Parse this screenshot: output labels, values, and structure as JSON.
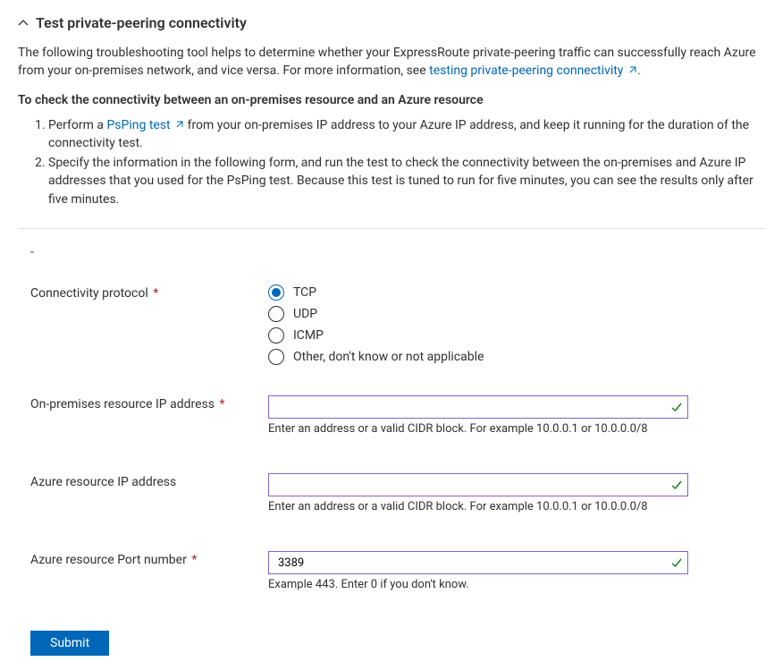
{
  "header": {
    "title": "Test private-peering connectivity"
  },
  "intro": {
    "prefix": "The following troubleshooting tool helps to determine whether your ExpressRoute private-peering traffic can successfully reach Azure from your on-premises network, and vice versa. For more information, see ",
    "link": "testing private-peering connectivity",
    "suffix": "."
  },
  "subheading": "To check the connectivity between an on-premises resource and an Azure resource",
  "steps": {
    "one_prefix": "Perform a ",
    "one_link": "PsPing test",
    "one_suffix": " from your on-premises IP address to your Azure IP address, and keep it running for the duration of the connectivity test.",
    "two": "Specify the information in the following form, and run the test to check the connectivity between the on-premises and Azure IP addresses that you used for the PsPing test. Because this test is tuned to run for five minutes, you can see the results only after five minutes."
  },
  "dash": "-",
  "form": {
    "protocol": {
      "label": "Connectivity protocol",
      "required_marker": "*",
      "options": {
        "tcp": "TCP",
        "udp": "UDP",
        "icmp": "ICMP",
        "other": "Other, don't know or not applicable"
      },
      "selected": "tcp"
    },
    "onprem_ip": {
      "label": "On-premises resource IP address",
      "required_marker": "*",
      "value": "",
      "hint": "Enter an address or a valid CIDR block. For example 10.0.0.1 or 10.0.0.0/8"
    },
    "azure_ip": {
      "label": "Azure resource IP address",
      "value": "",
      "hint": "Enter an address or a valid CIDR block. For example 10.0.0.1 or 10.0.0.0/8"
    },
    "azure_port": {
      "label": "Azure resource Port number",
      "required_marker": "*",
      "value": "3389",
      "hint": "Example 443. Enter 0 if you don't know."
    },
    "submit": "Submit"
  }
}
